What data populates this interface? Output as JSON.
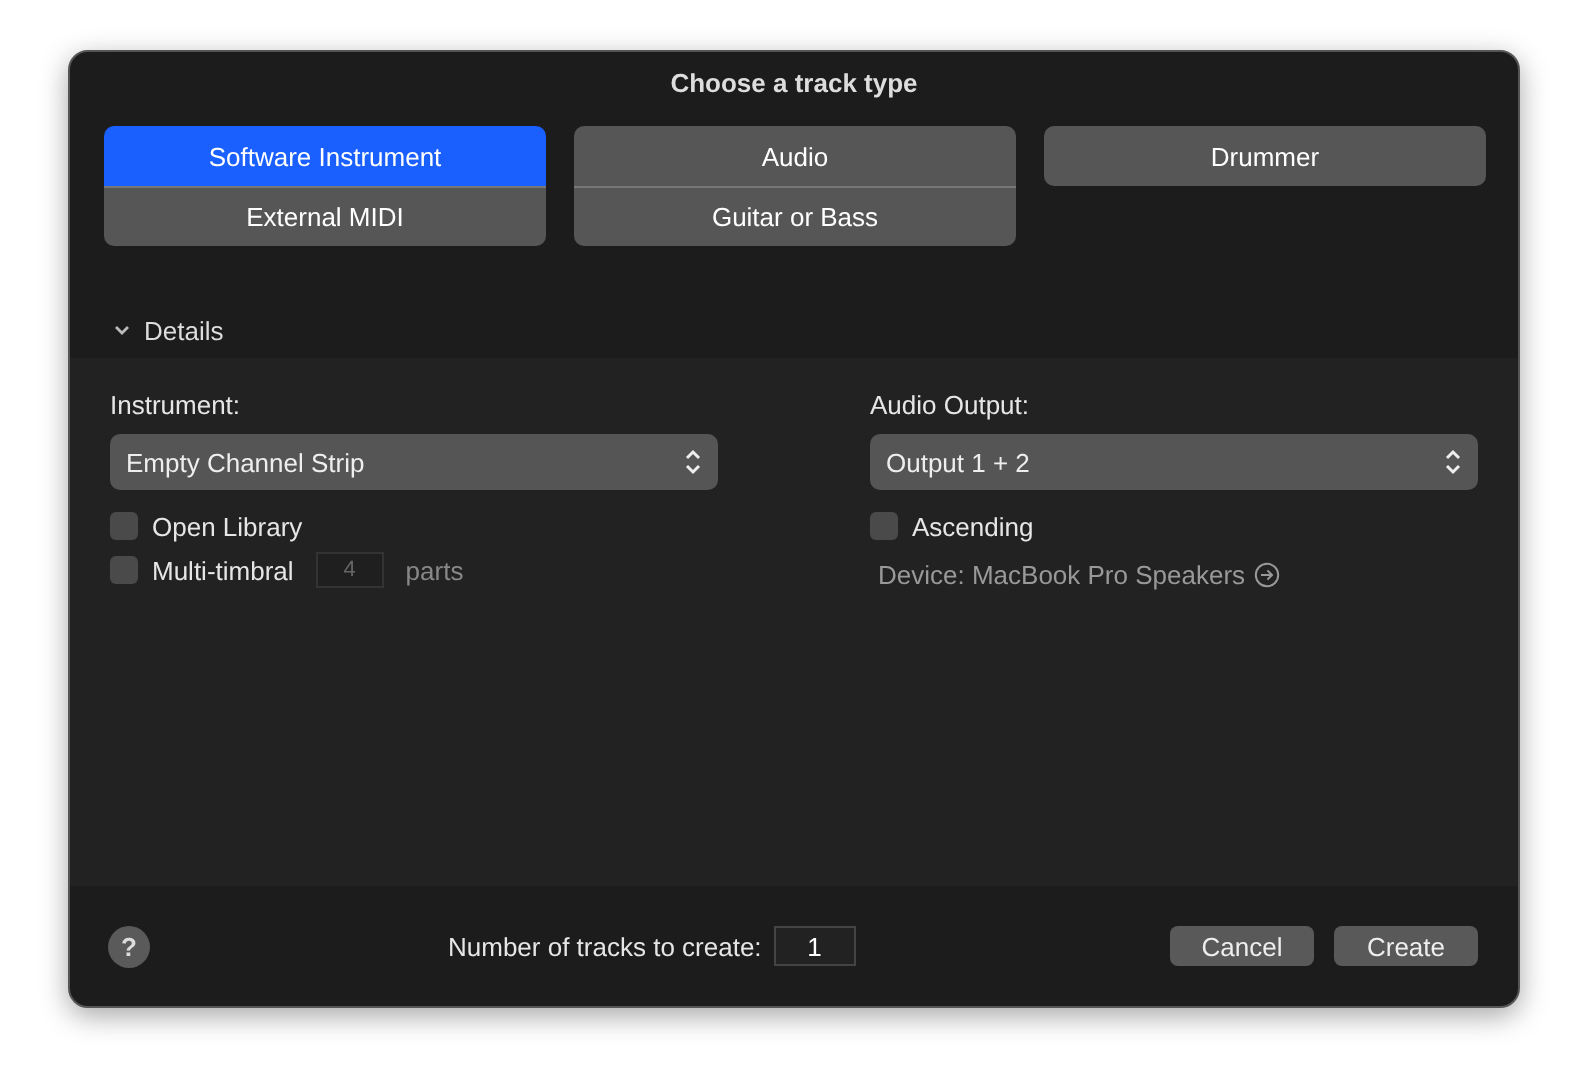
{
  "window": {
    "title": "Choose a track type"
  },
  "track_types": [
    {
      "buttons": [
        {
          "label": "Software Instrument",
          "selected": true
        },
        {
          "label": "External MIDI",
          "selected": false
        }
      ]
    },
    {
      "buttons": [
        {
          "label": "Audio",
          "selected": false
        },
        {
          "label": "Guitar or Bass",
          "selected": false
        }
      ]
    },
    {
      "buttons": [
        {
          "label": "Drummer",
          "selected": false
        }
      ]
    }
  ],
  "details": {
    "label": "Details",
    "expanded": true,
    "left": {
      "label": "Instrument:",
      "popup": "Empty Channel Strip",
      "options": [
        {
          "kind": "checkbox",
          "label": "Open Library",
          "checked": false
        },
        {
          "kind": "checkbox-field",
          "label": "Multi-timbral",
          "checked": false,
          "value": "4",
          "disabled": true,
          "suffix": "parts"
        }
      ]
    },
    "right": {
      "label": "Audio Output:",
      "popup": "Output 1 + 2",
      "options": [
        {
          "kind": "checkbox",
          "label": "Ascending",
          "checked": false
        },
        {
          "kind": "link",
          "label": "Device: MacBook Pro Speakers",
          "disabled": true
        }
      ]
    }
  },
  "footer": {
    "help": "?",
    "count_label": "Number of tracks to create:",
    "count_value": "1",
    "buttons": [
      "Cancel",
      "Create"
    ]
  }
}
